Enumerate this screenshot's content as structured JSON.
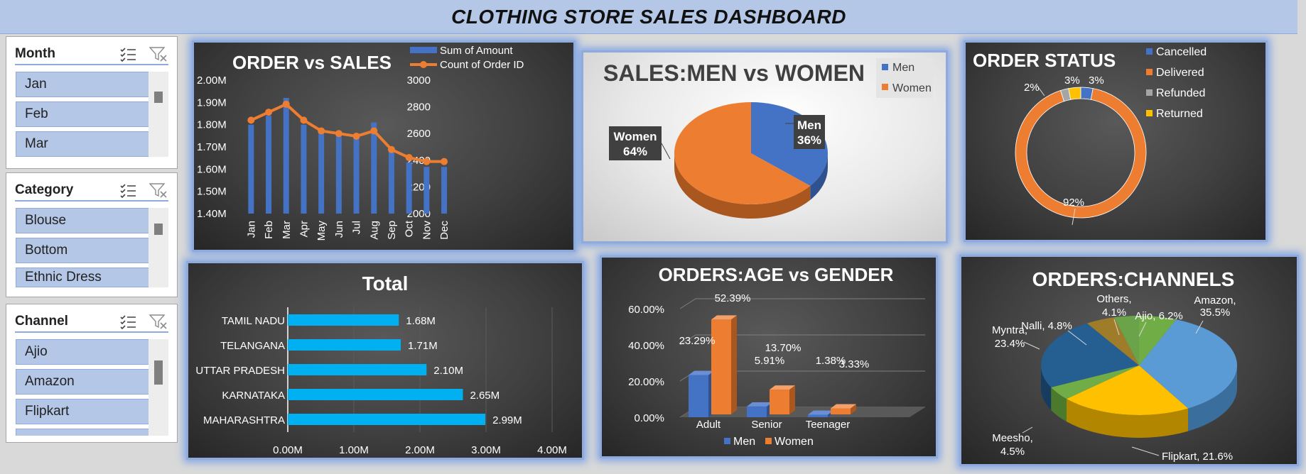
{
  "dashboard": {
    "title": "CLOTHING STORE SALES DASHBOARD"
  },
  "slicers": {
    "month": {
      "title": "Month",
      "items": [
        "Jan",
        "Feb",
        "Mar"
      ]
    },
    "category": {
      "title": "Category",
      "items": [
        "Blouse",
        "Bottom",
        "Ethnic Dress"
      ]
    },
    "channel": {
      "title": "Channel",
      "items": [
        "Ajio",
        "Amazon",
        "Flipkart"
      ]
    }
  },
  "icons": {
    "multiselect": "multi-select-icon",
    "clear_filter": "clear-filter-icon"
  },
  "colors": {
    "blue": "#4472c4",
    "orange": "#ed7d31",
    "gray": "#a5a5a5",
    "yellow": "#ffc000",
    "cyan": "#00b0f0",
    "slicer_fill": "#b4c7e7"
  },
  "chart_data": [
    {
      "id": "order_vs_sales",
      "type": "bar",
      "title": "ORDER vs SALES",
      "categories": [
        "Jan",
        "Feb",
        "Mar",
        "Apr",
        "May",
        "Jun",
        "Jul",
        "Aug",
        "Sep",
        "Oct",
        "Nov",
        "Dec"
      ],
      "series": [
        {
          "name": "Sum of Amount",
          "axis": "left",
          "values": [
            1.8,
            1.84,
            1.92,
            1.8,
            1.78,
            1.75,
            1.74,
            1.81,
            1.68,
            1.63,
            1.61,
            1.61
          ]
        },
        {
          "name": "Count of Order ID",
          "axis": "right",
          "type": "line",
          "values": [
            2700,
            2760,
            2820,
            2700,
            2620,
            2600,
            2580,
            2620,
            2480,
            2420,
            2390,
            2390
          ]
        }
      ],
      "left_ticks": [
        "2.00M",
        "1.90M",
        "1.80M",
        "1.70M",
        "1.60M",
        "1.50M",
        "1.40M"
      ],
      "left_range": [
        1.4,
        2.0
      ],
      "right_ticks": [
        "3000",
        "2800",
        "2600",
        "2400",
        "2200",
        "2000"
      ],
      "right_range": [
        2000,
        3000
      ]
    },
    {
      "id": "sales_men_women",
      "type": "pie",
      "title": "SALES:MEN vs WOMEN",
      "categories": [
        "Men",
        "Women"
      ],
      "values": [
        36,
        64
      ],
      "labels": [
        [
          "Men",
          "36%"
        ],
        [
          "Women",
          "64%"
        ]
      ]
    },
    {
      "id": "order_status",
      "type": "pie",
      "title": "ORDER STATUS",
      "categories": [
        "Cancelled",
        "Delivered",
        "Refunded",
        "Returned"
      ],
      "values": [
        3,
        92,
        2,
        3
      ],
      "labels": [
        "3%",
        "92%",
        "2%",
        "3%"
      ]
    },
    {
      "id": "total_by_state",
      "type": "bar",
      "orientation": "horizontal",
      "title": "Total",
      "categories": [
        "TAMIL NADU",
        "TELANGANA",
        "UTTAR PRADESH",
        "KARNATAKA",
        "MAHARASHTRA"
      ],
      "values": [
        1.68,
        1.71,
        2.1,
        2.65,
        2.99
      ],
      "value_labels": [
        "1.68M",
        "1.71M",
        "2.10M",
        "2.65M",
        "2.99M"
      ],
      "x_ticks": [
        "0.00M",
        "1.00M",
        "2.00M",
        "3.00M",
        "4.00M"
      ],
      "x_range": [
        0,
        4
      ]
    },
    {
      "id": "orders_age_gender",
      "type": "bar",
      "title": "ORDERS:AGE vs GENDER",
      "categories": [
        "Adult",
        "Senior",
        "Teenager"
      ],
      "series": [
        {
          "name": "Men",
          "values": [
            23.29,
            5.91,
            1.38
          ],
          "labels": [
            "23.29%",
            "5.91%",
            "1.38%"
          ]
        },
        {
          "name": "Women",
          "values": [
            52.39,
            13.7,
            3.33
          ],
          "labels": [
            "52.39%",
            "13.70%",
            "3.33%"
          ]
        }
      ],
      "y_ticks": [
        "60.00%",
        "40.00%",
        "20.00%",
        "0.00%"
      ],
      "y_range": [
        0,
        60
      ]
    },
    {
      "id": "orders_channels",
      "type": "pie",
      "title": "ORDERS:CHANNELS",
      "categories": [
        "Amazon",
        "Flipkart",
        "Meesho",
        "Myntra",
        "Nalli",
        "Others",
        "Ajio"
      ],
      "values": [
        35.5,
        21.6,
        4.5,
        23.4,
        4.8,
        4.1,
        6.2
      ],
      "labels": [
        [
          "Amazon,",
          "35.5%"
        ],
        [
          "Flipkart, 21.6%"
        ],
        [
          "Meesho,",
          "4.5%"
        ],
        [
          "Myntra,",
          "23.4%"
        ],
        [
          "Nalli, 4.8%"
        ],
        [
          "Others,",
          "4.1%"
        ],
        [
          "Ajio, 6.2%"
        ]
      ]
    }
  ]
}
